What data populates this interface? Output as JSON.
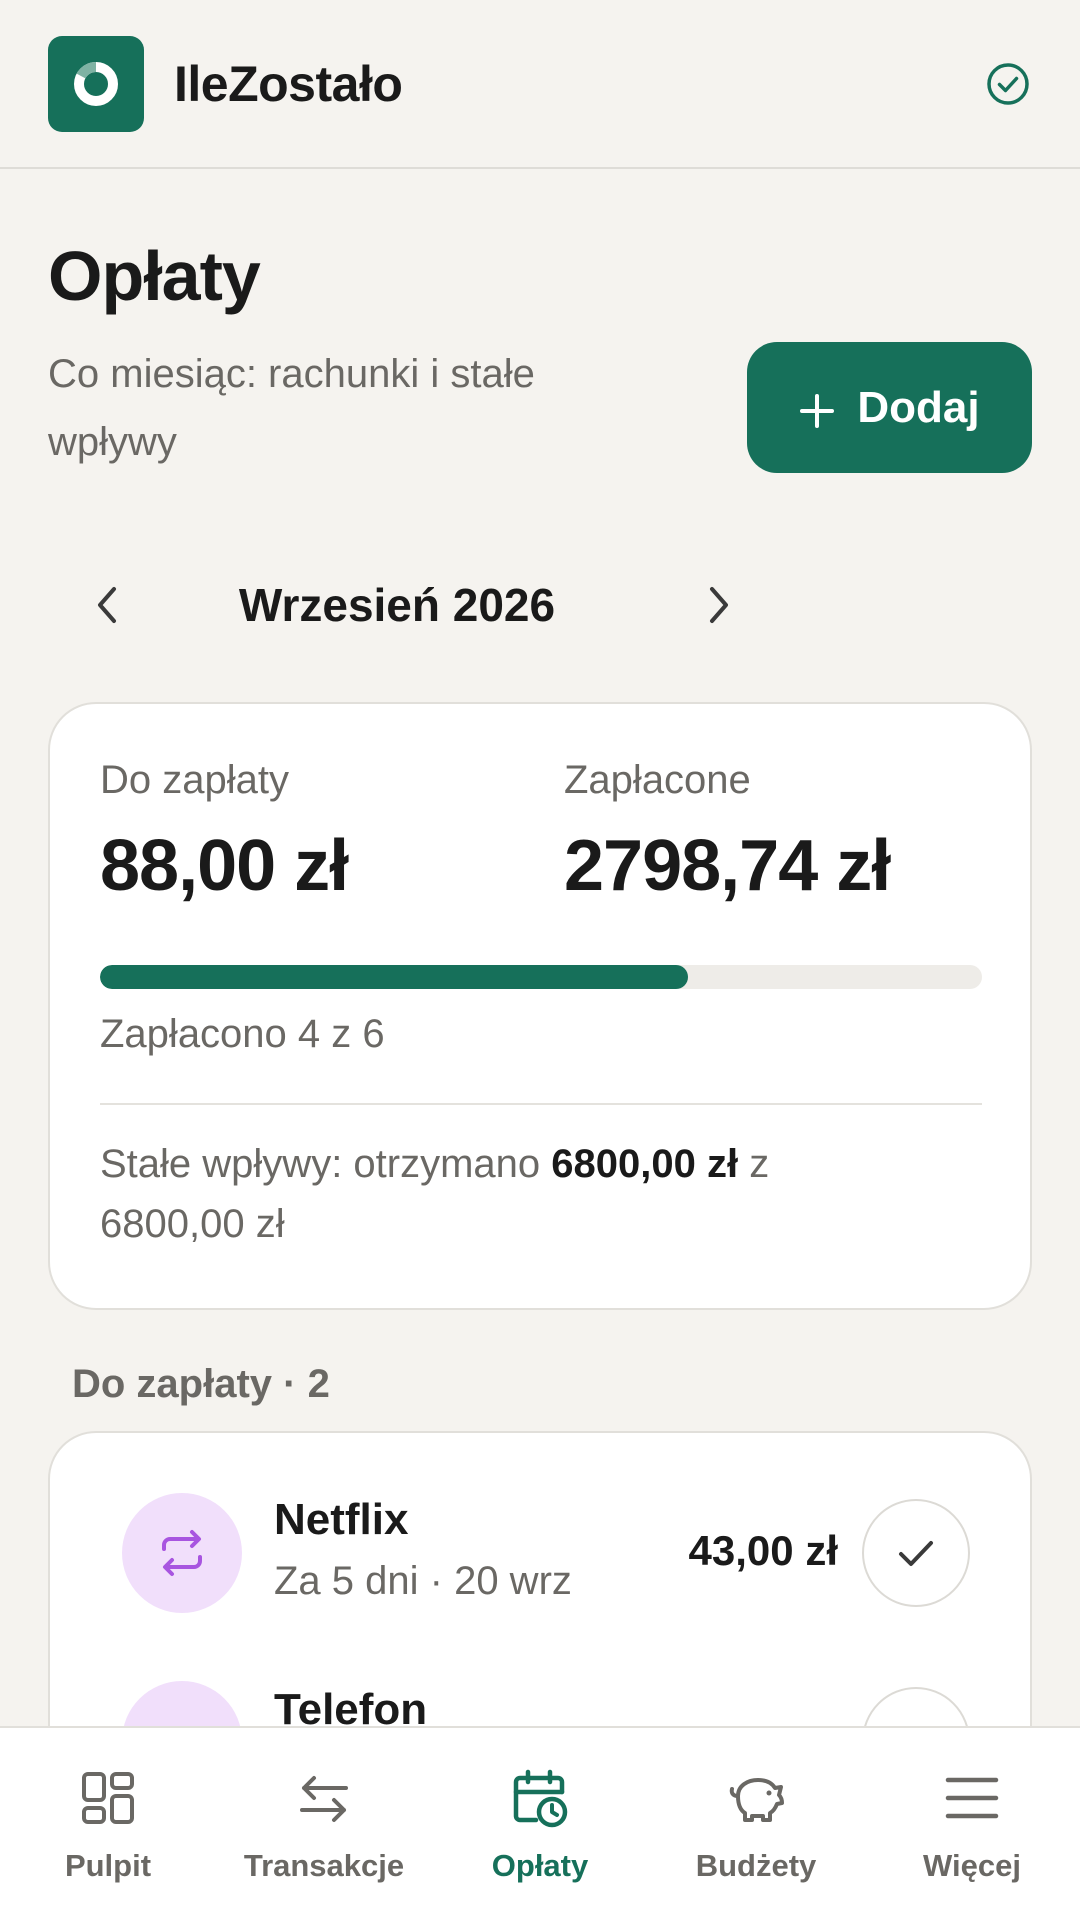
{
  "header": {
    "app_name": "IleZostało",
    "logo_icon": "ring-logo-icon",
    "sync_icon": "check-circle-icon"
  },
  "page": {
    "title": "Opłaty",
    "subtitle": "Co miesiąc: rachunki i stałe wpływy",
    "add_label": "Dodaj"
  },
  "month_nav": {
    "label": "Wrzesień 2026",
    "prev_icon": "chevron-left-icon",
    "next_icon": "chevron-right-icon"
  },
  "summary": {
    "due_label": "Do zapłaty",
    "due_value": "88,00 zł",
    "paid_label": "Zapłacone",
    "paid_value": "2798,74 zł",
    "progress_fraction": 0.667,
    "progress_text": "Zapłacono 4 z 6",
    "income_prefix": "Stałe wpływy: otrzymano ",
    "income_received": "6800,00 zł",
    "income_suffix": " z 6800,00 zł"
  },
  "section": {
    "title": "Do zapłaty · 2"
  },
  "bills": [
    {
      "name": "Netflix",
      "meta": "Za 5 dni · 20 wrz",
      "amount": "43,00 zł",
      "icon": "repeat-icon"
    },
    {
      "name": "Telefon",
      "meta": "",
      "amount": "",
      "icon": "repeat-icon"
    }
  ],
  "bottom_nav": [
    {
      "label": "Pulpit",
      "icon": "dashboard-grid-icon",
      "active": false
    },
    {
      "label": "Transakcje",
      "icon": "swap-arrows-icon",
      "active": false
    },
    {
      "label": "Opłaty",
      "icon": "calendar-clock-icon",
      "active": true
    },
    {
      "label": "Budżety",
      "icon": "piggy-bank-icon",
      "active": false
    },
    {
      "label": "Więcej",
      "icon": "menu-icon",
      "active": false
    }
  ],
  "colors": {
    "accent": "#16705a",
    "background": "#f5f3ef",
    "recurring_icon_bg": "#f1dffb",
    "recurring_icon_fg": "#a855e0"
  }
}
